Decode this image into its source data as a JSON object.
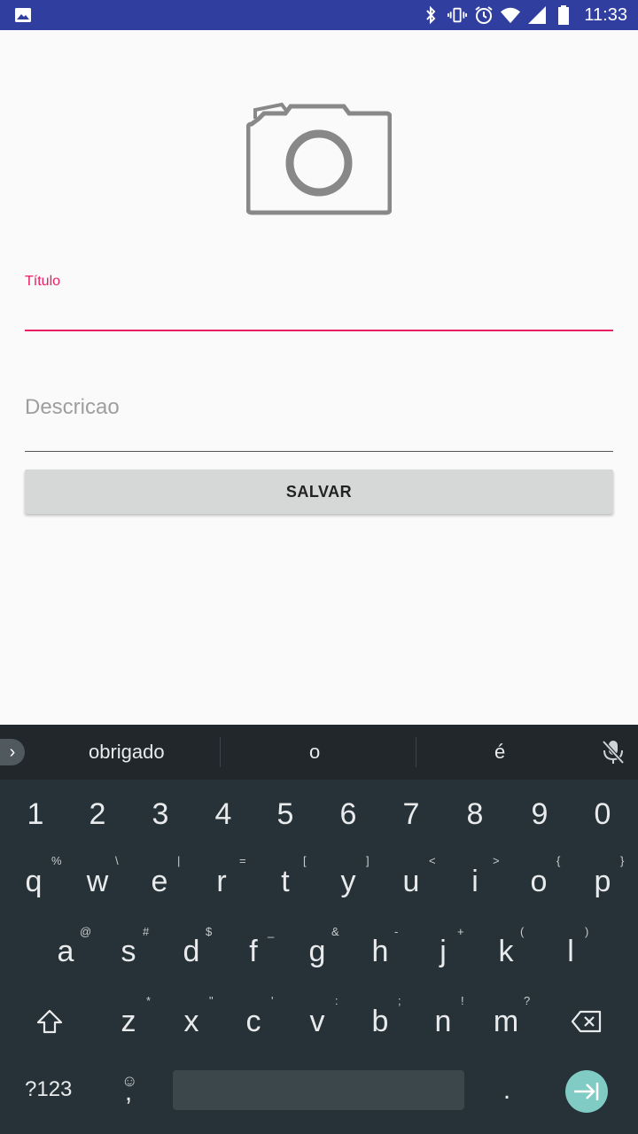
{
  "status_bar": {
    "time": "11:33",
    "icons": [
      "image-icon",
      "bluetooth-icon",
      "vibrate-icon",
      "alarm-icon",
      "wifi-icon",
      "signal-icon",
      "battery-icon"
    ],
    "color": "#303f9f"
  },
  "form": {
    "image_placeholder": "camera-icon",
    "titulo_label": "Título",
    "titulo_value": "",
    "descricao_hint": "Descricao",
    "save_label": "SALVAR",
    "accent_color": "#e91e63"
  },
  "keyboard": {
    "suggestions": [
      "obrigado",
      "o",
      "é"
    ],
    "number_row": [
      "1",
      "2",
      "3",
      "4",
      "5",
      "6",
      "7",
      "8",
      "9",
      "0"
    ],
    "row1": [
      "q",
      "w",
      "e",
      "r",
      "t",
      "y",
      "u",
      "i",
      "o",
      "p"
    ],
    "row1_hints": [
      "%",
      "\\",
      "|",
      "=",
      "[",
      "]",
      "<",
      ">",
      "{",
      "}"
    ],
    "row2": [
      "a",
      "s",
      "d",
      "f",
      "g",
      "h",
      "j",
      "k",
      "l"
    ],
    "row2_hints": [
      "@",
      "#",
      "$",
      "_",
      "&",
      "-",
      "+",
      "(",
      ")"
    ],
    "row3": [
      "z",
      "x",
      "c",
      "v",
      "b",
      "n",
      "m"
    ],
    "row3_hints": [
      "*",
      "\"",
      "'",
      ":",
      ";",
      "!",
      "?"
    ],
    "symbols_label": "?123",
    "comma": ",",
    "period": ".",
    "emoji_hint": "☺"
  }
}
